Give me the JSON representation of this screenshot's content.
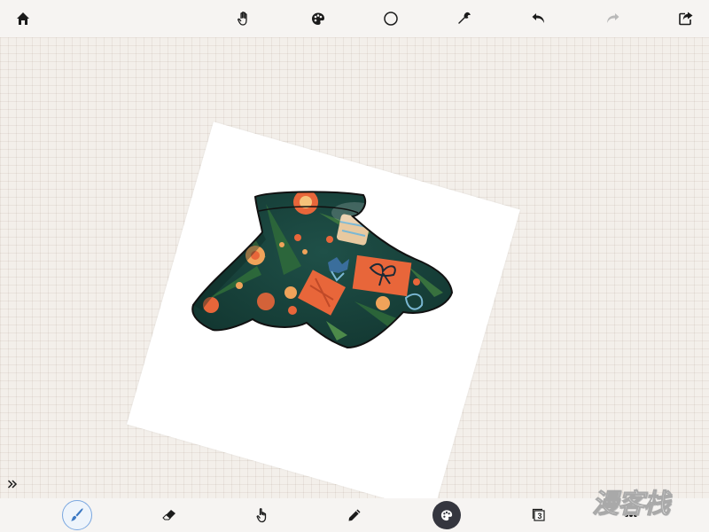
{
  "app": {
    "accent_color": "#7aa7e0",
    "toolbar_bg": "#f6f4f2",
    "canvas_bg": "#f3efea"
  },
  "top_toolbar": {
    "items": [
      {
        "icon": "home-icon"
      },
      {
        "icon": "hand-icon"
      },
      {
        "icon": "palette-icon"
      },
      {
        "icon": "circle-icon"
      },
      {
        "icon": "wrench-icon"
      },
      {
        "icon": "undo-icon"
      },
      {
        "icon": "redo-icon"
      },
      {
        "icon": "share-icon"
      }
    ]
  },
  "bottom_toolbar": {
    "items": [
      {
        "icon": "brush-icon",
        "active": true
      },
      {
        "icon": "eraser-icon"
      },
      {
        "icon": "pointer-hand-icon"
      },
      {
        "icon": "pencil-icon"
      },
      {
        "icon": "color-palette-icon"
      },
      {
        "icon": "layers-icon",
        "layer_count": "3"
      },
      {
        "icon": "more-icon"
      }
    ]
  },
  "canvas": {
    "paper_color": "#ffffff",
    "artwork": {
      "fabric_base": "#1d4a44",
      "outline": "#111111",
      "accents": [
        "#e8663a",
        "#f0a35a",
        "#3a6e9c",
        "#7bb8d4",
        "#2f6b3a",
        "#e8c9a0"
      ]
    }
  },
  "side": {
    "expand_icon": "double-chevron-right-icon"
  },
  "watermark": {
    "text": "漫客栈"
  }
}
